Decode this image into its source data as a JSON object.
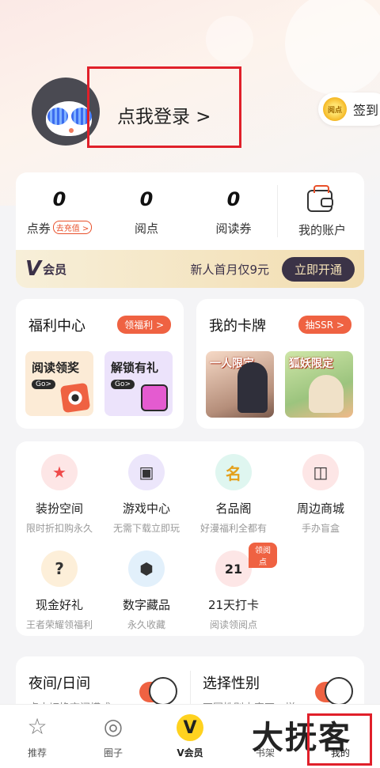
{
  "header": {
    "login_text": "点我登录 >",
    "signin_label": "签到",
    "coin_text": "阅点"
  },
  "account": {
    "stats": [
      {
        "value": "0",
        "label": "点券",
        "chip": "去充值 >"
      },
      {
        "value": "0",
        "label": "阅点"
      },
      {
        "value": "0",
        "label": "阅读券"
      }
    ],
    "wallet_label": "我的账户"
  },
  "vip_banner": {
    "logo": "V",
    "logo_text": "会员",
    "promo": "新人首月仅9元",
    "button": "立即开通"
  },
  "welfare": {
    "title": "福利中心",
    "pill": "领福利 >",
    "tiles": [
      {
        "title": "阅读领奖",
        "go": "Go>"
      },
      {
        "title": "解锁有礼",
        "go": "Go>"
      }
    ]
  },
  "cards": {
    "title": "我的卡牌",
    "pill": "抽SSR >",
    "images": [
      {
        "caption": "一人限定"
      },
      {
        "caption": "狐妖限定"
      }
    ]
  },
  "services": {
    "items": [
      {
        "name": "装扮空间",
        "sub": "限时折扣购永久",
        "icon": "shirt-star-icon"
      },
      {
        "name": "游戏中心",
        "sub": "无需下载立即玩",
        "icon": "gamepad-icon"
      },
      {
        "name": "名品阁",
        "sub": "好漫福利全都有",
        "icon": "ming-badge-icon"
      },
      {
        "name": "周边商城",
        "sub": "手办盲盒",
        "icon": "shop-bag-icon"
      },
      {
        "name": "现金好礼",
        "sub": "王者荣耀领福利",
        "icon": "gift-box-icon"
      },
      {
        "name": "数字藏品",
        "sub": "永久收藏",
        "icon": "cube-icon"
      },
      {
        "name": "21天打卡",
        "sub": "阅读领阅点",
        "icon": "calendar-21-icon",
        "badge": "领阅点"
      }
    ]
  },
  "preferences": {
    "night": {
      "title": "夜间/日间",
      "sub": "点击切换夜间模式"
    },
    "gender": {
      "title": "选择性别",
      "sub": "不同性别内容不一样"
    }
  },
  "tabbar": {
    "tabs": [
      {
        "label": "推荐"
      },
      {
        "label": "圈子"
      },
      {
        "label": "V会员"
      },
      {
        "label": "书架"
      },
      {
        "label": "我的"
      }
    ]
  },
  "watermark": "大抚客",
  "colors": {
    "accent": "#ef6242",
    "highlight": "#e0202a",
    "vip_dark": "#3b3347",
    "vip_gold": "#f2ddb0"
  }
}
